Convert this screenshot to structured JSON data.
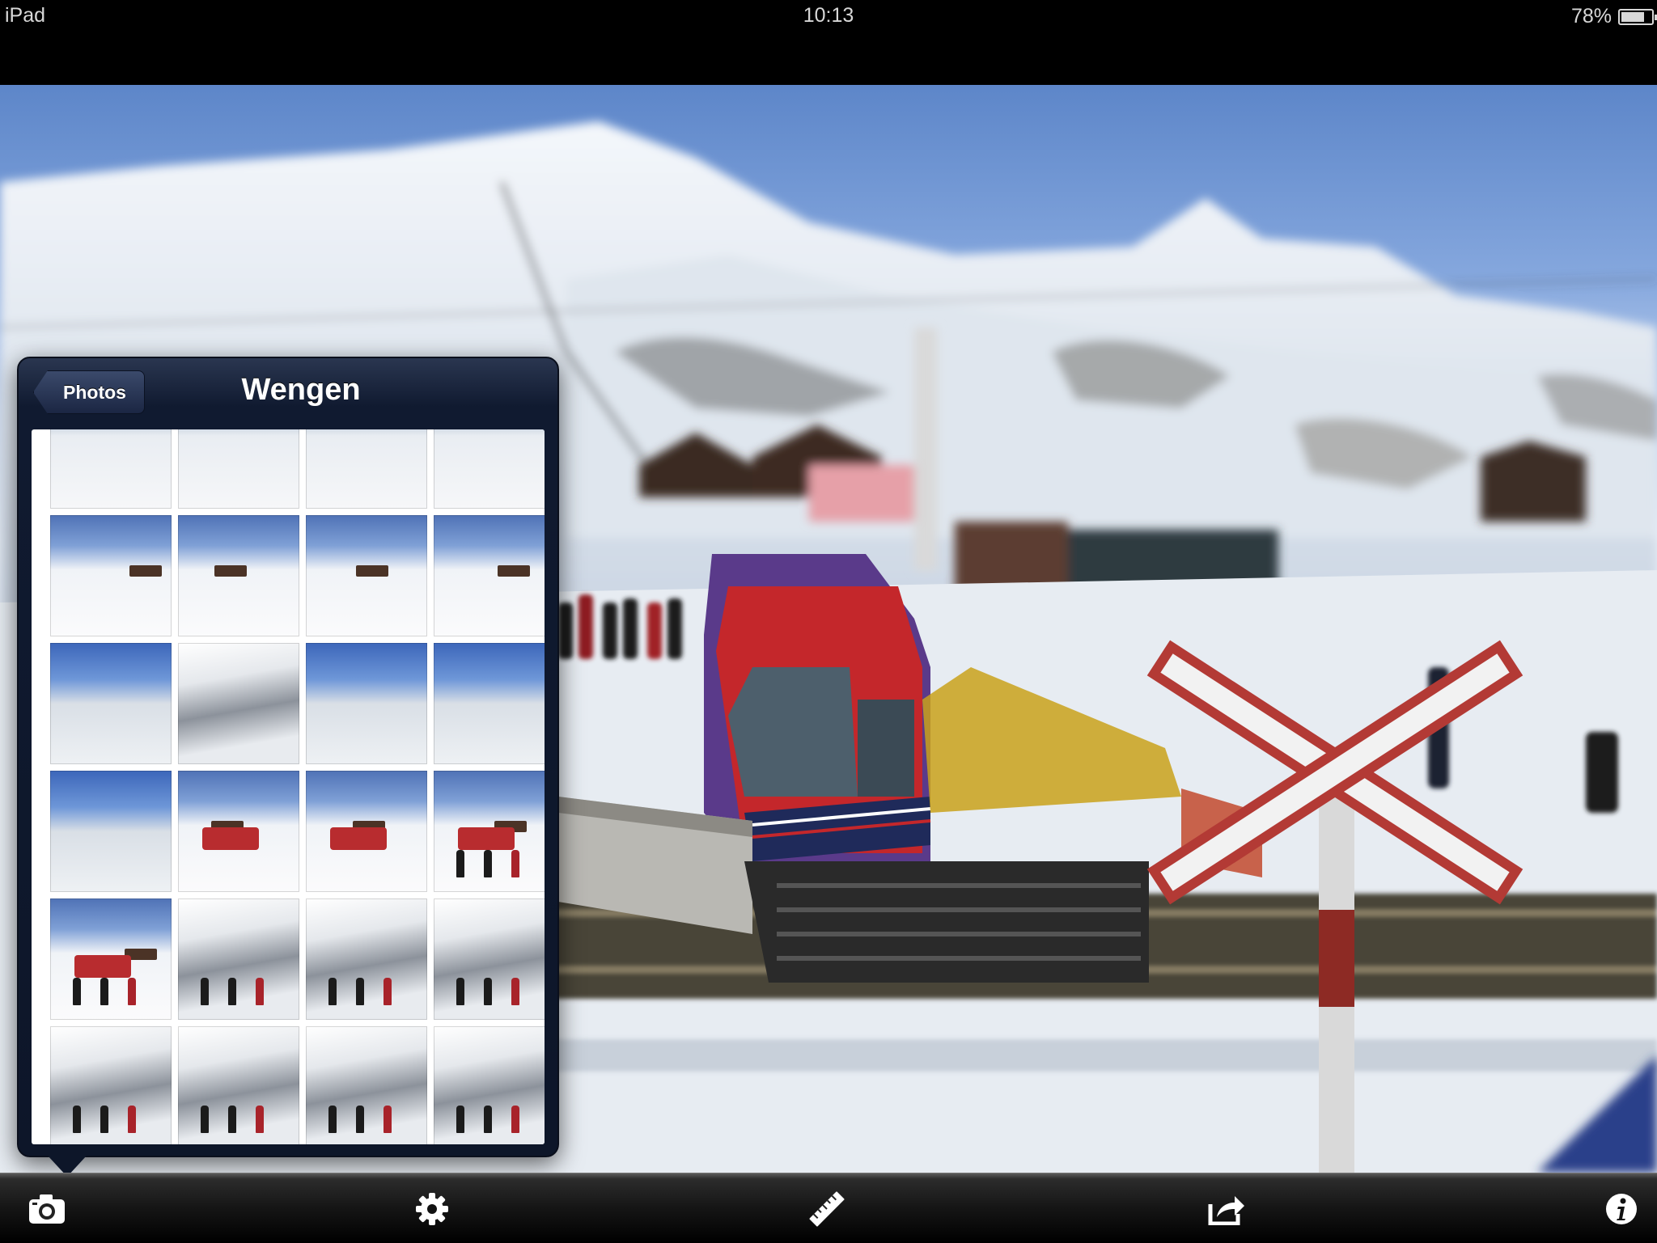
{
  "status_bar": {
    "carrier": "iPad",
    "time": "10:13",
    "battery_percent": "78%",
    "battery_level": 0.78
  },
  "popover": {
    "back_label": "Photos",
    "title": "Wengen",
    "thumbnail_count": 24
  },
  "toolbar": {
    "items": [
      {
        "name": "camera-icon"
      },
      {
        "name": "gear-icon"
      },
      {
        "name": "ruler-icon"
      },
      {
        "name": "share-icon"
      },
      {
        "name": "info-icon"
      }
    ]
  },
  "colors": {
    "popover_bg": "#0d1629",
    "toolbar_bg": "#151515",
    "sky": "#5d86c9",
    "snow": "#eef2f7"
  }
}
